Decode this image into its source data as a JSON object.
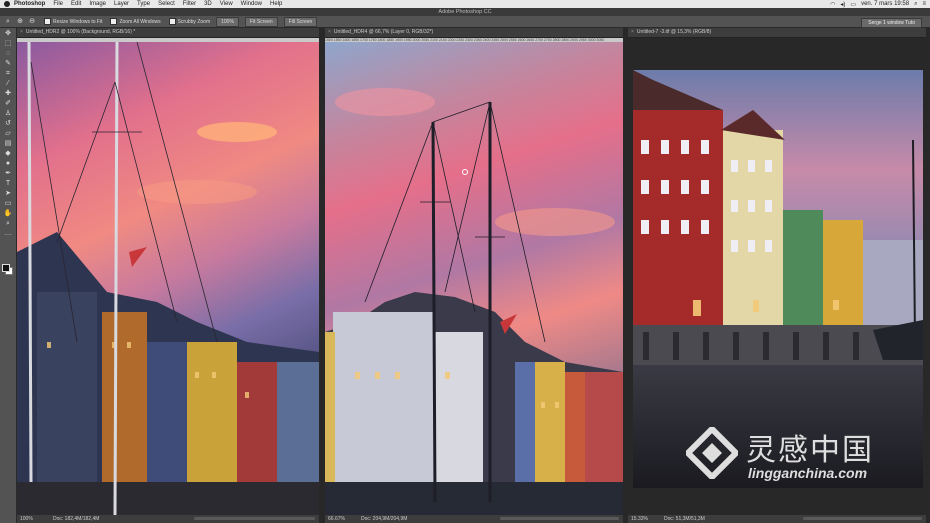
{
  "menubar": {
    "app": "Photoshop",
    "items": [
      "File",
      "Edit",
      "Image",
      "Layer",
      "Type",
      "Select",
      "Filter",
      "3D",
      "View",
      "Window",
      "Help"
    ],
    "clock": "ven. 7 mars  19:58"
  },
  "window_title": "Adobe Photoshop CC",
  "options": {
    "resize_windows": "Resize Windows to Fit",
    "zoom_all": "Zoom All Windows",
    "scrubby_zoom": "Scrubby Zoom",
    "zoom_value": "100%",
    "fit_screen": "Fit Screen",
    "fill_screen": "Fill Screen",
    "workspace": "Serge 1 window Tuto"
  },
  "documents": [
    {
      "tab": "Untitled_HDR2 @ 100% (Background, RGB/16) *",
      "zoom": "100%",
      "doc": "Doc: 182,4M/182,4M"
    },
    {
      "tab": "Untitled_HDR4 @ 66,7% (Layer 0, RGB/32*)",
      "zoom": "66.67%",
      "doc": "Doc: 204,9M/204,9M",
      "ruler": "1500 1550 1600 1650 1700 1750 1800 1850 1900 1950 2000 2050 2100 2150 2200 2250 2300 2350 2400 2450 2500 2550 2600 2650 2700 2750 2800 2850 2900 2950 3000 3050"
    },
    {
      "tab": "Untitled-7 -3.tif @ 15,3% (RGB/8)",
      "zoom": "15.33%",
      "doc": "Doc: 51,3M/51,3M"
    }
  ],
  "watermark": {
    "title": "灵感中国",
    "url": "lingganchina.com"
  }
}
